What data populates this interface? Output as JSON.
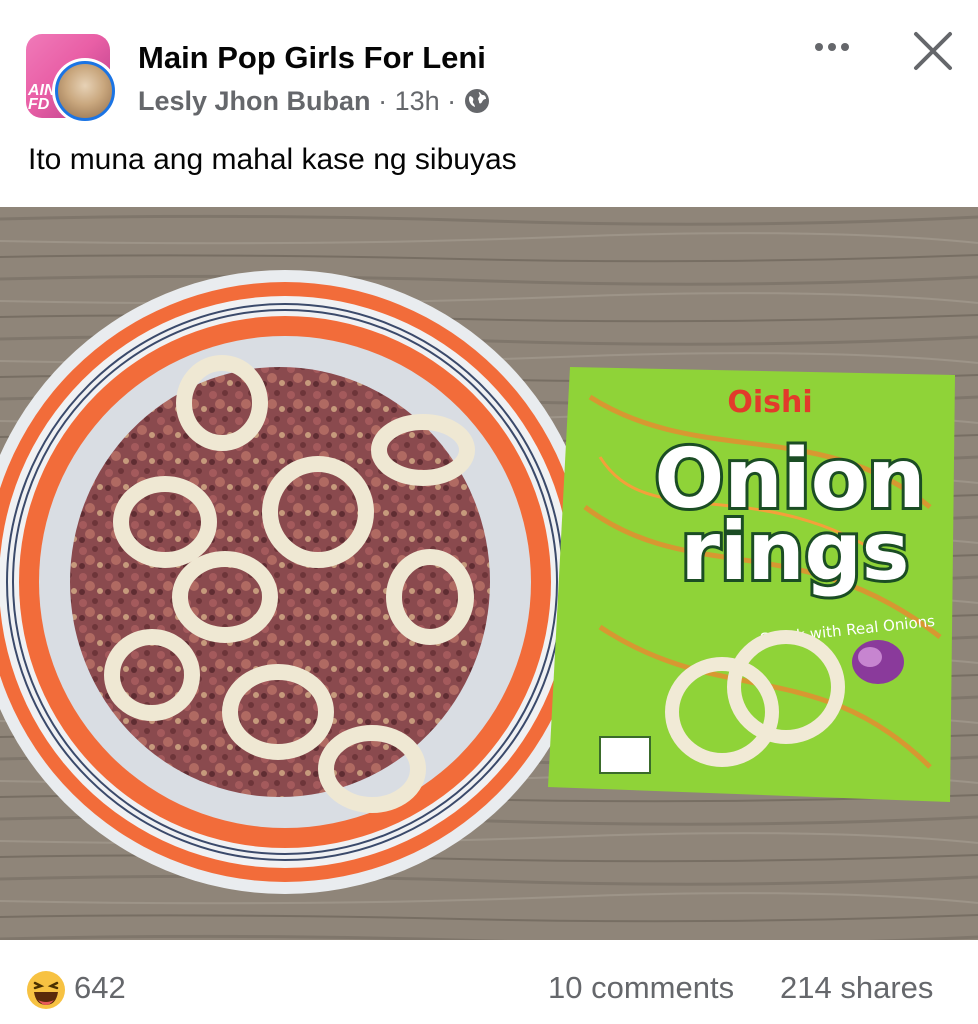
{
  "post": {
    "group_name": "Main Pop Girls For Leni",
    "group_avatar_text": "AIN\nFD",
    "author": "Lesly Jhon Buban",
    "separator": "·",
    "time": "13h",
    "privacy_icon": "globe-icon",
    "caption": "Ito muna ang mahal kase ng sibuyas"
  },
  "image": {
    "alt": "Plate of corned beef topped with onion ring snacks next to an Onion Rings snack bag",
    "bag_brand": "Oishi",
    "bag_title_line1": "Onion",
    "bag_title_line2": "rings",
    "bag_tagline": "Snack with Real Onions"
  },
  "footer": {
    "reaction_icon": "laughing-emoji-icon",
    "reaction_count": "642",
    "comments": "10 comments",
    "shares": "214 shares"
  },
  "colors": {
    "link_blue": "#1b74e4",
    "secondary_text": "#65676b",
    "primary_text": "#050505"
  }
}
